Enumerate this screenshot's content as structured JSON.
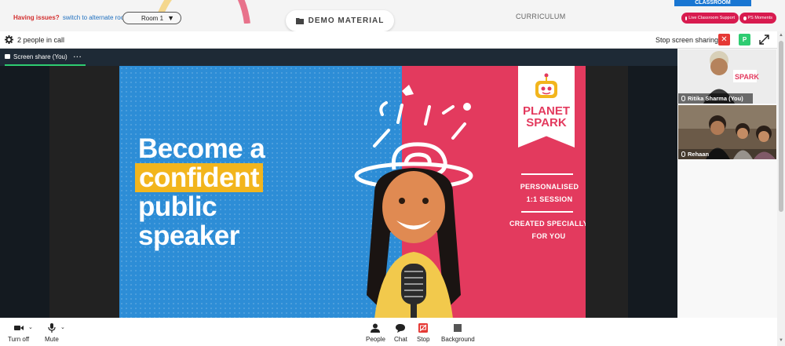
{
  "topbar": {
    "issue_question": "Having issues?",
    "issue_link": "switch to alternate room",
    "room_value": "Room 1",
    "demo_label": "DEMO MATERIAL",
    "curriculum_label": "CURRICULUM",
    "classroom_label": "CLASSROOM",
    "live_support_label": "Live Classroom Support",
    "ps_moments_label": "PS Moments"
  },
  "call": {
    "people_count": "2 people in call",
    "stop_share_label": "Stop screen sharing",
    "stop_x": "✕",
    "p_badge": "P",
    "share_tab_label": "Screen share (You)",
    "share_tab_more": "···"
  },
  "slide": {
    "line1": "Become a",
    "line2": "confident",
    "line3": "public",
    "line4": "speaker",
    "brand_line1": "PLANET",
    "brand_line2": "SPARK",
    "text_block1_a": "PERSONALISED",
    "text_block1_b": "1:1 SESSION",
    "text_block2_a": "CREATED SPECIALLY",
    "text_block2_b": "FOR YOU",
    "colors": {
      "blue": "#2d8dd6",
      "pink": "#e33a5e",
      "yellow": "#f2b51d"
    }
  },
  "participants": [
    {
      "name": "Ritika Sharma (You)"
    },
    {
      "name": "Rehaan"
    }
  ],
  "toolbar": {
    "camera_label": "Turn off",
    "mic_label": "Mute",
    "people_label": "People",
    "chat_label": "Chat",
    "stop_label": "Stop",
    "background_label": "Background"
  }
}
